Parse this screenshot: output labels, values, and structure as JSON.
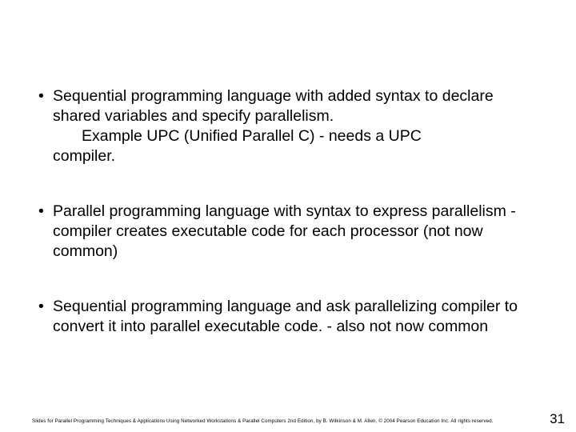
{
  "bullets": {
    "b1": {
      "line1": "Sequential programming language with added syntax to declare shared variables and specify parallelism.",
      "line2a": "Example UPC (Unified Parallel C) - needs a UPC",
      "line2b": "compiler."
    },
    "b2": {
      "text": "Parallel programming language with syntax to express parallelism -  compiler creates executable code for each processor (not now common)"
    },
    "b3": {
      "text": "Sequential programming language and ask parallelizing compiler to convert it into parallel executable code. - also not now common"
    }
  },
  "footer": "Slides for Parallel Programming Techniques & Applications Using Networked Workstations & Parallel Computers 2nd Edition, by B. Wilkinson & M. Allen, © 2004 Pearson Education Inc. All rights reserved.",
  "page_number": "31",
  "dot": "•"
}
